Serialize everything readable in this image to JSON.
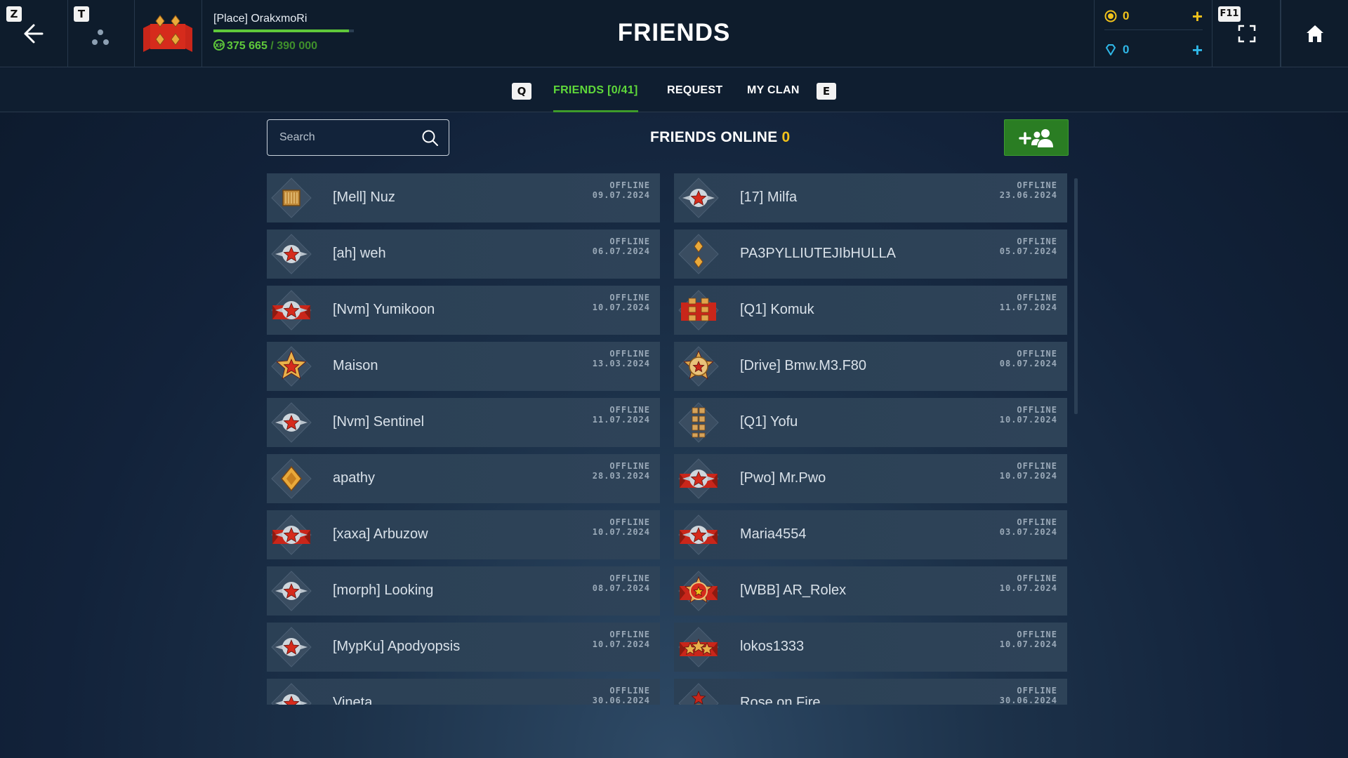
{
  "topbar": {
    "back_key": "Z",
    "social_key": "T",
    "fullscreen_key": "F11",
    "player_name": "[Place] OrakxmoRi",
    "xp_current": "375 665",
    "xp_max": "/ 390 000",
    "xp_progress": 0.963,
    "title": "FRIENDS",
    "gold": "0",
    "gems": "0",
    "gold_plus": "+",
    "gem_plus": "+"
  },
  "tabs": {
    "prev_key": "Q",
    "next_key": "E",
    "friends": "FRIENDS [0/41]",
    "request": "REQUEST",
    "my_clan": "MY CLAN"
  },
  "search": {
    "placeholder": "Search"
  },
  "online": {
    "label": "FRIENDS ONLINE",
    "count": "0"
  },
  "friends": [
    {
      "name": "[Mell] Nuz",
      "status": "OFFLINE",
      "date": "09.07.2024",
      "rank": "bar-gold-icon"
    },
    {
      "name": "[17] Milfa",
      "status": "OFFLINE",
      "date": "23.06.2024",
      "rank": "star-silver-icon"
    },
    {
      "name": "[ah] weh",
      "status": "OFFLINE",
      "date": "06.07.2024",
      "rank": "star-silver-icon"
    },
    {
      "name": "PA3PYLLIUTEJIbHULLA",
      "status": "OFFLINE",
      "date": "05.07.2024",
      "rank": "two-diamonds-icon"
    },
    {
      "name": "[Nvm] Yumikoon",
      "status": "OFFLINE",
      "date": "10.07.2024",
      "rank": "star-red-wings-icon"
    },
    {
      "name": "[Q1] Komuk",
      "status": "OFFLINE",
      "date": "11.07.2024",
      "rank": "bars-red-icon"
    },
    {
      "name": "Maison",
      "status": "OFFLINE",
      "date": "13.03.2024",
      "rank": "star-gold-icon"
    },
    {
      "name": "[Drive] Bmw.M3.F80",
      "status": "OFFLINE",
      "date": "08.07.2024",
      "rank": "medal-gold-icon"
    },
    {
      "name": "[Nvm] Sentinel",
      "status": "OFFLINE",
      "date": "11.07.2024",
      "rank": "star-silver-icon"
    },
    {
      "name": "[Q1] Yofu",
      "status": "OFFLINE",
      "date": "10.07.2024",
      "rank": "bars-gold-icon"
    },
    {
      "name": "apathy",
      "status": "OFFLINE",
      "date": "28.03.2024",
      "rank": "diamond-gold-icon"
    },
    {
      "name": "[Pwo] Mr.Pwo",
      "status": "OFFLINE",
      "date": "10.07.2024",
      "rank": "star-red-wings-icon"
    },
    {
      "name": "[xaxa] Arbuzow",
      "status": "OFFLINE",
      "date": "10.07.2024",
      "rank": "star-red-wings-icon"
    },
    {
      "name": "Maria4554",
      "status": "OFFLINE",
      "date": "03.07.2024",
      "rank": "star-red-wings-icon"
    },
    {
      "name": "[morph] Looking",
      "status": "OFFLINE",
      "date": "08.07.2024",
      "rank": "star-silver-icon"
    },
    {
      "name": "[WBB] AR_Rolex",
      "status": "OFFLINE",
      "date": "10.07.2024",
      "rank": "medal-red-icon"
    },
    {
      "name": "[MypKu] Apodyopsis",
      "status": "OFFLINE",
      "date": "10.07.2024",
      "rank": "star-silver-icon"
    },
    {
      "name": "lokos1333",
      "status": "OFFLINE",
      "date": "10.07.2024",
      "rank": "triple-star-red-icon"
    },
    {
      "name": "Vineta",
      "status": "OFFLINE",
      "date": "30.06.2024",
      "rank": "star-silver-icon"
    },
    {
      "name": "Rose on Fire",
      "status": "OFFLINE",
      "date": "30.06.2024",
      "rank": "star-bronze-icon"
    }
  ],
  "colors": {
    "accent_green": "#5fd93a",
    "gold": "#f1c21b",
    "gem": "#2fb8e8",
    "card_bg": "#2b4055"
  }
}
